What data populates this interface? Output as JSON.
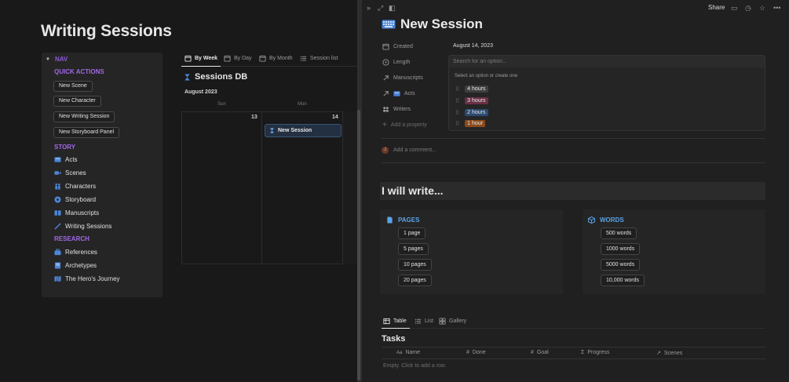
{
  "left": {
    "page_title": "Writing Sessions",
    "nav": {
      "header": "NAV",
      "quick_actions_label": "QUICK ACTIONS",
      "quick_actions": [
        "New Scene",
        "New Character",
        "New Writing Session",
        "New Storyboard Panel"
      ],
      "story_label": "STORY",
      "story_items": [
        {
          "label": "Acts",
          "icon": "acts-icon"
        },
        {
          "label": "Scenes",
          "icon": "video-camera-icon"
        },
        {
          "label": "Characters",
          "icon": "people-icon"
        },
        {
          "label": "Storyboard",
          "icon": "storyboard-icon"
        },
        {
          "label": "Manuscripts",
          "icon": "book-icon"
        },
        {
          "label": "Writing Sessions",
          "icon": "pencil-icon"
        }
      ],
      "research_label": "RESEARCH",
      "research_items": [
        {
          "label": "References",
          "icon": "briefcase-icon"
        },
        {
          "label": "Archetypes",
          "icon": "archetypes-icon"
        },
        {
          "label": "The Hero's Journey",
          "icon": "map-icon"
        }
      ]
    },
    "view_tabs": [
      "By Week",
      "By Day",
      "By Month",
      "Session list"
    ],
    "db_title": "Sessions DB",
    "calendar": {
      "month": "August 2023",
      "days": [
        "Sun",
        "Mon"
      ],
      "day_numbers": [
        "13",
        "14"
      ],
      "card": "New Session"
    }
  },
  "peek": {
    "share_label": "Share",
    "title": "New Session",
    "properties": {
      "created_label": "Created",
      "created_value": "August 14, 2023",
      "length_label": "Length",
      "manuscripts_label": "Manuscripts",
      "acts_label": "Acts",
      "writers_label": "Writers",
      "add_property_label": "Add a property"
    },
    "dropdown": {
      "placeholder": "Search for an option...",
      "hint": "Select an option or create one",
      "options": [
        {
          "label": "4 hours",
          "color": "#3f3f3f"
        },
        {
          "label": "3 hours",
          "color": "#693045"
        },
        {
          "label": "2 hours",
          "color": "#2b4a70"
        },
        {
          "label": "1 hour",
          "color": "#8a4a1c"
        }
      ]
    },
    "comment_placeholder": "Add a comment...",
    "avatar_letter": "J",
    "heading": "I will write...",
    "pages_panel": {
      "title": "PAGES",
      "buttons": [
        "1 page",
        "5 pages",
        "10 pages",
        "20 pages"
      ]
    },
    "words_panel": {
      "title": "WORDS",
      "buttons": [
        "500 words",
        "1000 words",
        "5000 words",
        "10,000 words"
      ]
    },
    "bottom_tabs": [
      "Table",
      "List",
      "Gallery"
    ],
    "tasks_title": "Tasks",
    "columns": [
      "Name",
      "Done",
      "Goal",
      "Progress",
      "Scenes"
    ],
    "empty_text": "Empty. Click to add a row."
  },
  "colors": {
    "accent_purple": "#a168e6",
    "accent_blue": "#5ba3e8",
    "background": "#191919"
  }
}
